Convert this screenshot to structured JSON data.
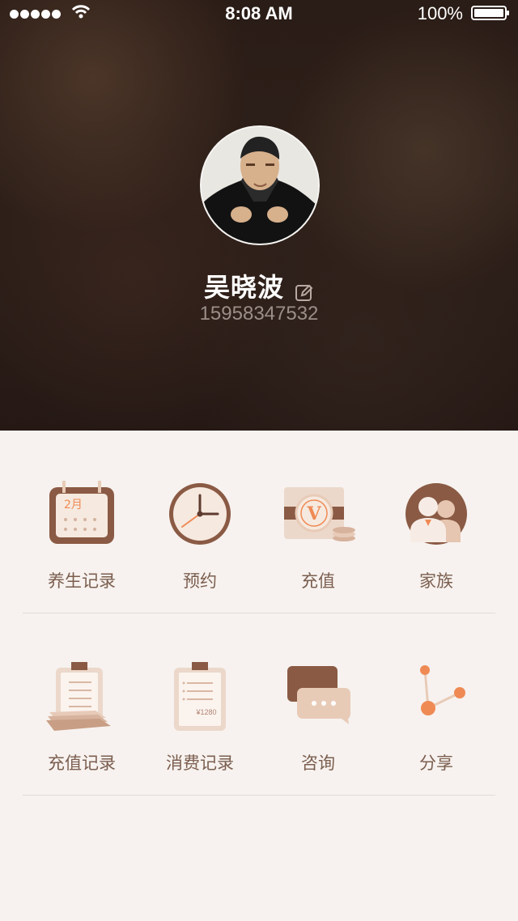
{
  "status_bar": {
    "time": "8:08 AM",
    "battery": "100%"
  },
  "profile": {
    "name": "吴晓波",
    "phone": "15958347532"
  },
  "menu": [
    {
      "label": "养生记录",
      "icon": "calendar-icon"
    },
    {
      "label": "预约",
      "icon": "clock-icon"
    },
    {
      "label": "充值",
      "icon": "recharge-icon"
    },
    {
      "label": "家族",
      "icon": "family-icon"
    },
    {
      "label": "充值记录",
      "icon": "recharge-record-icon"
    },
    {
      "label": "消费记录",
      "icon": "consumption-record-icon"
    },
    {
      "label": "咨询",
      "icon": "chat-icon"
    },
    {
      "label": "分享",
      "icon": "share-icon"
    }
  ],
  "icon_text": {
    "calendar_month": "2月",
    "recharge_letter": "V",
    "receipt_amount": "¥1280"
  },
  "colors": {
    "brown": "#8a5a44",
    "light_brown": "#e8cbb7",
    "orange": "#ef8a55"
  }
}
